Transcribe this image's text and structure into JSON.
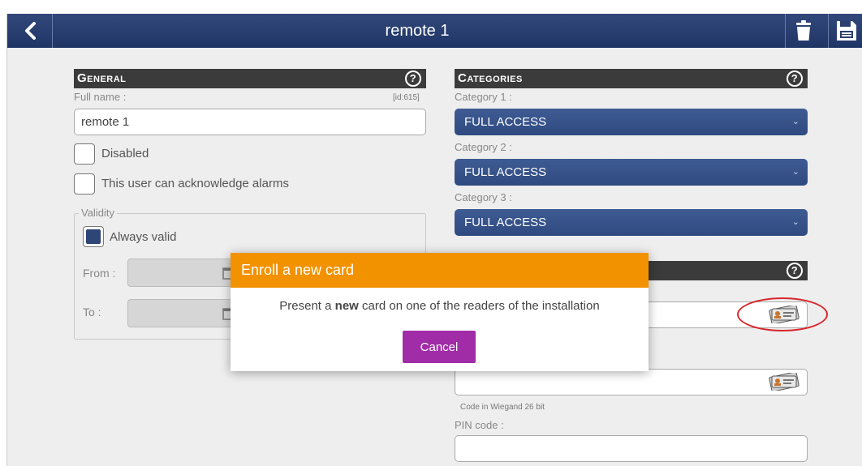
{
  "header": {
    "title": "remote 1"
  },
  "general": {
    "title": "General",
    "full_name_label": "Full name :",
    "id_label": "[id:615]",
    "full_name_value": "remote 1",
    "disabled_label": "Disabled",
    "ack_alarms_label": "This user can acknowledge alarms",
    "validity": {
      "legend": "Validity",
      "always_valid_label": "Always valid",
      "from_label": "From :",
      "to_label": "To :"
    }
  },
  "categories": {
    "title": "Categories",
    "category1_label": "Category 1 :",
    "category1_value": "FULL ACCESS",
    "category2_label": "Category 2 :",
    "category2_value": "FULL ACCESS",
    "category3_label": "Category 3 :",
    "category3_value": "FULL ACCESS"
  },
  "credentials": {
    "wiegand_note": "Code in Wiegand 26 bit",
    "pin_label": "PIN code :"
  },
  "modal": {
    "title": "Enroll a new card",
    "message_pre": "Present a ",
    "message_bold": "new",
    "message_post": " card on one of the readers of the installation",
    "cancel_label": "Cancel"
  },
  "colors": {
    "topbar": "#1f3566",
    "section_header": "#3b3b3b",
    "select": "#2e4a80",
    "modal_header": "#f39200",
    "cancel_button": "#a02ca7",
    "highlight_ellipse": "#d9262b"
  },
  "icons": [
    "back-chevron-icon",
    "trash-icon",
    "save-icon",
    "help-icon",
    "calendar-icon",
    "id-card-icon",
    "chevron-down-icon"
  ]
}
